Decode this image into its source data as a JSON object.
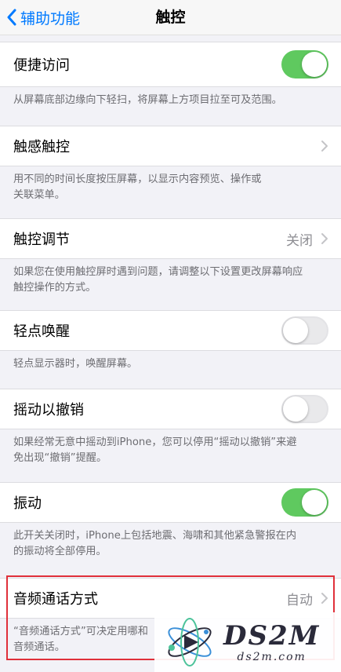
{
  "nav": {
    "back_label": "辅助功能",
    "title": "触控"
  },
  "settings": [
    {
      "label": "便捷访问",
      "toggle": "on",
      "footer": "从屏幕底部边缘向下轻扫，将屏幕上方项目拉至可及范围。"
    },
    {
      "label": "触感触控",
      "chevron": true,
      "footer_lines": [
        "用不同的时间长度按压屏幕，以显示内容预览、操作或",
        "关联菜单。"
      ]
    },
    {
      "label": "触控调节",
      "value": "关闭",
      "chevron": true,
      "footer_lines": [
        "如果您在使用触控屏时遇到问题，请调整以下设置更改屏幕响应",
        "触控操作的方式。"
      ]
    },
    {
      "label": "轻点唤醒",
      "toggle": "off",
      "footer": "轻点显示器时，唤醒屏幕。"
    },
    {
      "label": "摇动以撤销",
      "toggle": "off",
      "footer_lines": [
        "如果经常无意中摇动到iPhone，您可以停用“摇动以撤销”来避",
        "免出现“撤销”提醒。"
      ]
    },
    {
      "label": "振动",
      "toggle": "on",
      "footer_lines": [
        "此开关关闭时，iPhone上包括地震、海啸和其他紧急警报在内",
        "的振动将全部停用。"
      ]
    },
    {
      "label": "音频通话方式",
      "value": "自动",
      "chevron": true,
      "footer_lines": [
        "“音频通话方式”可决定用哪和",
        "音频通话。"
      ]
    }
  ],
  "watermark": {
    "title": "DS2M",
    "url": "ds2m.com"
  },
  "colors": {
    "accent": "#007aff",
    "toggle_on": "#5fc95f",
    "highlight": "#e0303a"
  }
}
